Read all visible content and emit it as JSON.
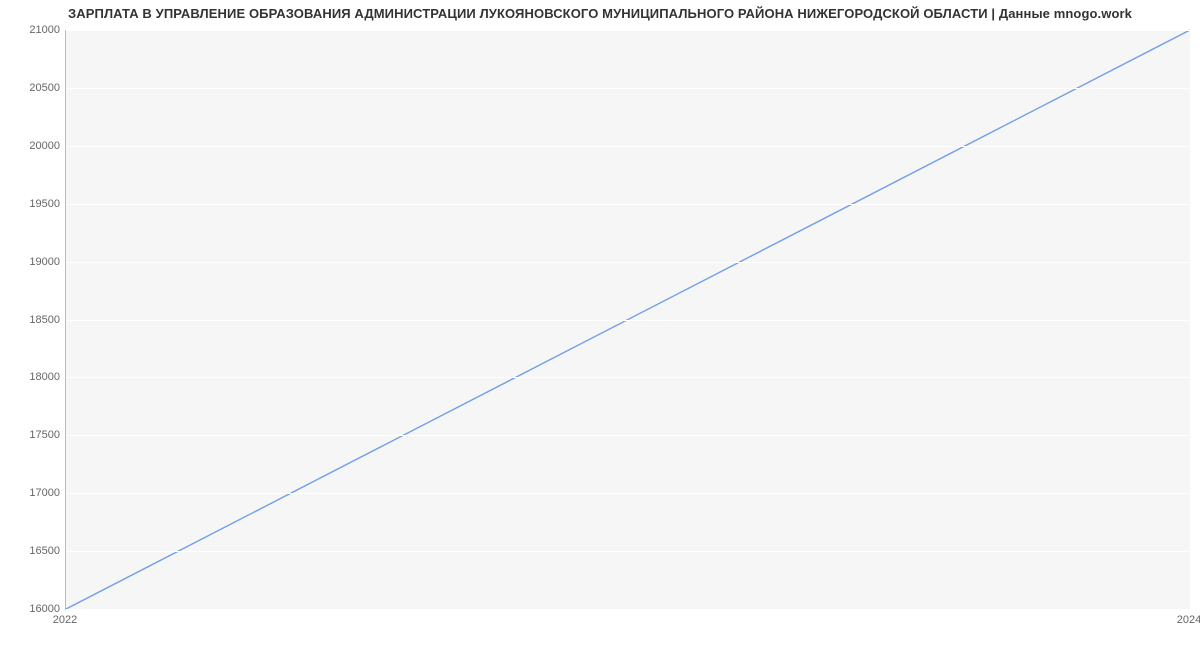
{
  "chart_data": {
    "type": "line",
    "title": "ЗАРПЛАТА В УПРАВЛЕНИЕ ОБРАЗОВАНИЯ АДМИНИСТРАЦИИ ЛУКОЯНОВСКОГО МУНИЦИПАЛЬНОГО РАЙОНА НИЖЕГОРОДСКОЙ ОБЛАСТИ | Данные mnogo.work",
    "x": [
      2022,
      2024
    ],
    "values": [
      16000,
      21000
    ],
    "xlabel": "",
    "ylabel": "",
    "y_ticks": [
      16000,
      16500,
      17000,
      17500,
      18000,
      18500,
      19000,
      19500,
      20000,
      20500,
      21000
    ],
    "x_ticks": [
      2022,
      2024
    ],
    "xlim": [
      2022,
      2024
    ],
    "ylim": [
      16000,
      21000
    ],
    "line_color": "#6f9fe8",
    "plot_bg": "#f6f6f6"
  }
}
